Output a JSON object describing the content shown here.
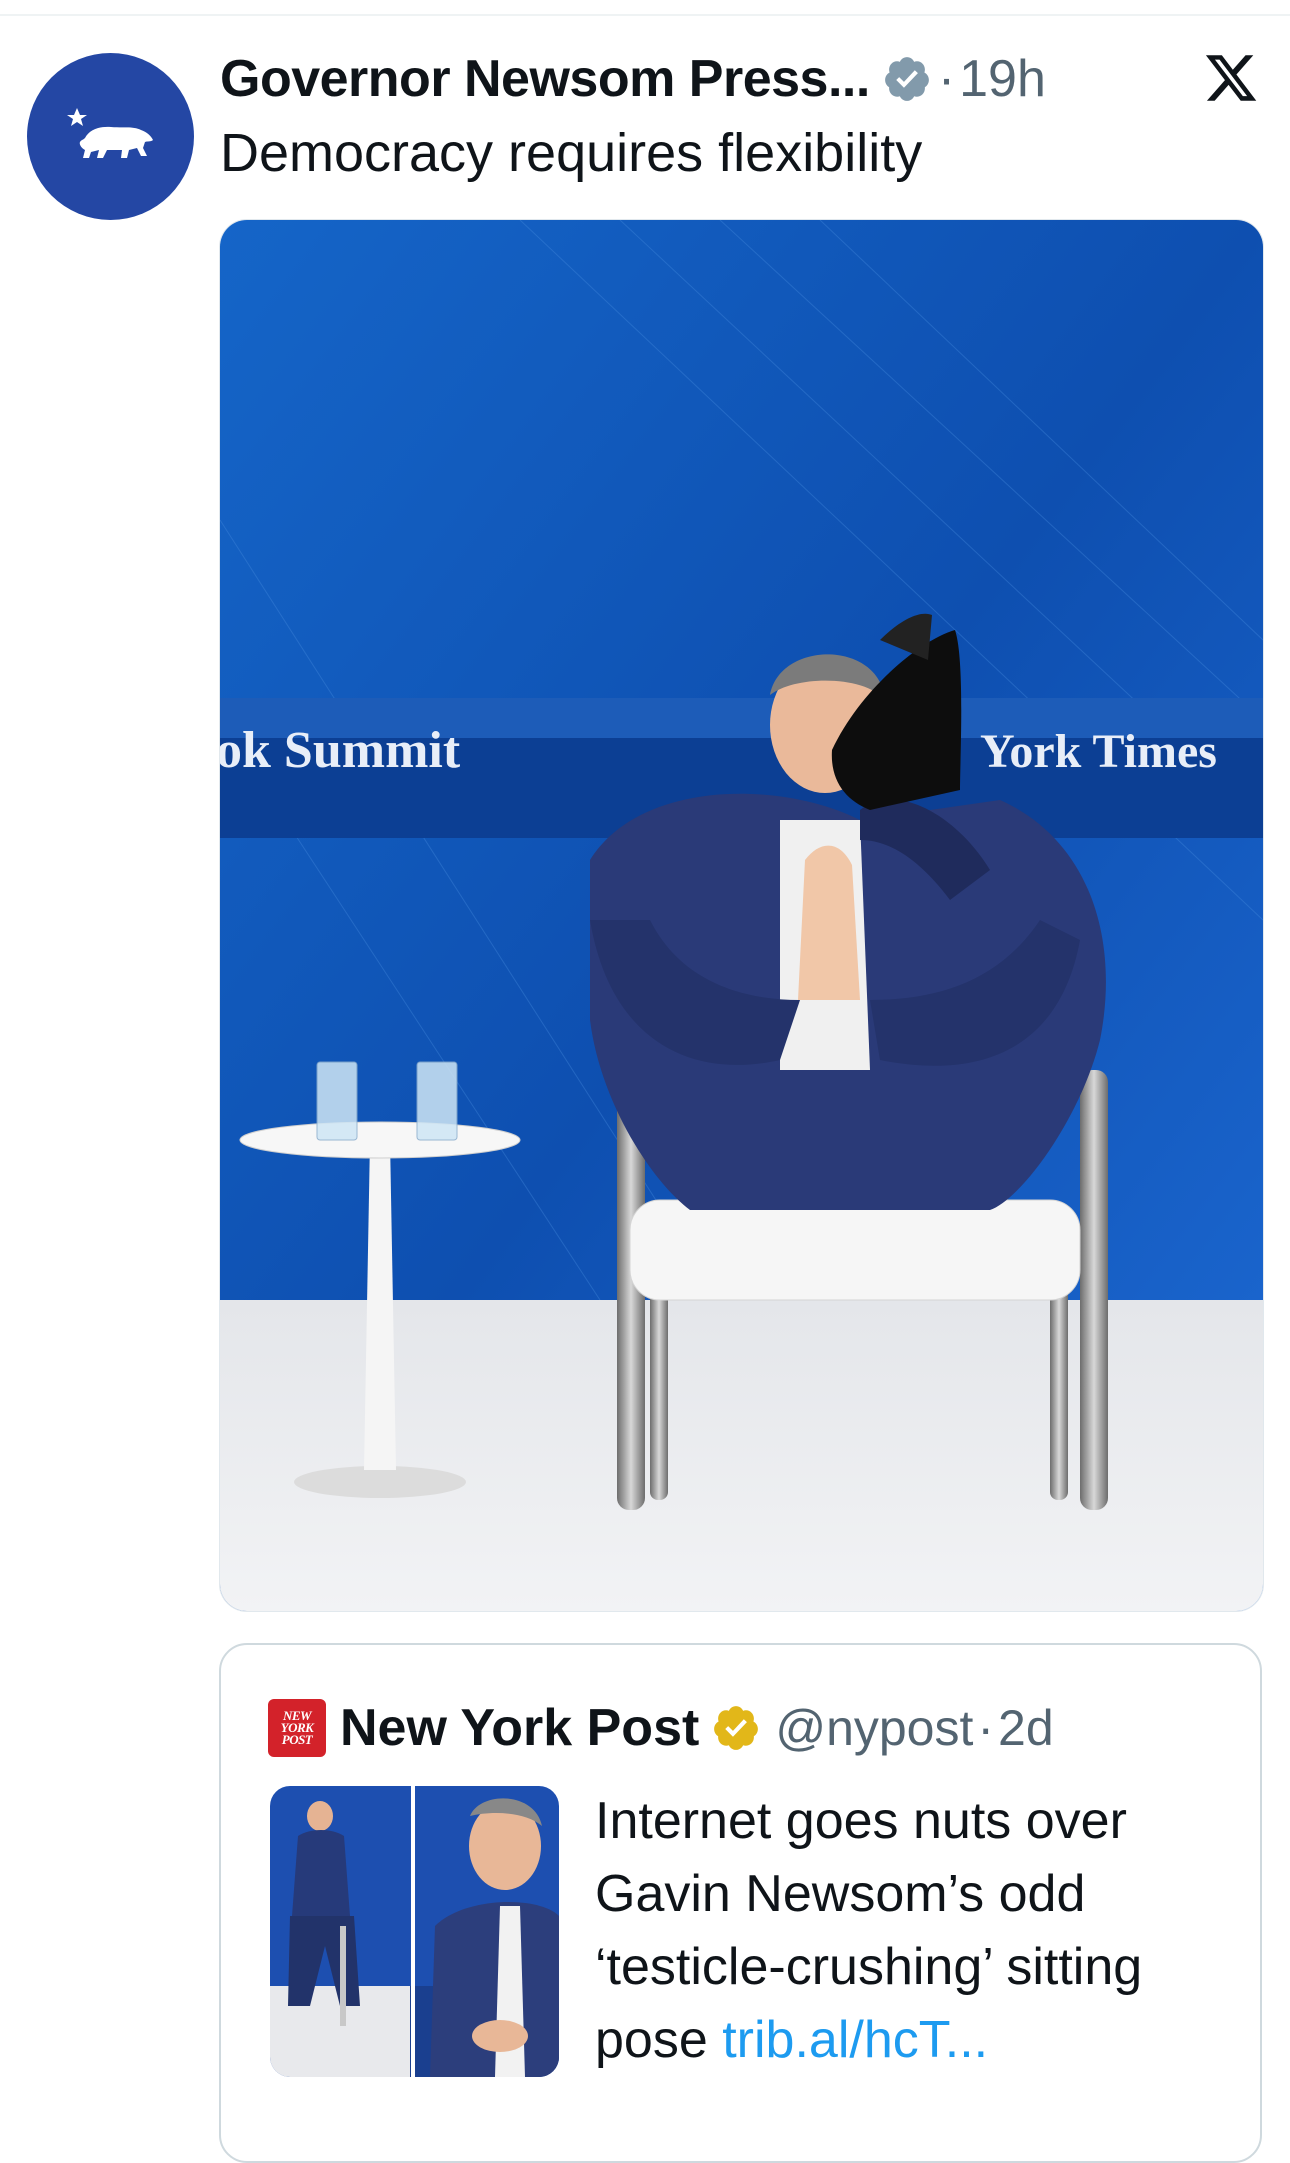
{
  "tweet": {
    "author_name": "Governor Newsom Press...",
    "verified_icon": "verified-badge-icon",
    "separator": "·",
    "timestamp": "19h",
    "text": "Democracy requires flexibility",
    "avatar_icon": "california-bear-icon",
    "platform_icon": "x-logo-icon"
  },
  "media": {
    "backdrop_left_text": "ok Summit",
    "backdrop_right_text": "York Times"
  },
  "quote": {
    "logo_lines": [
      "NEW",
      "YORK",
      "POST"
    ],
    "author_name": "New York Post",
    "verified_icon": "gold-verified-badge-icon",
    "handle": "@nypost",
    "separator": "·",
    "timestamp": "2d",
    "text": "Internet goes nuts over Gavin Newsom’s odd ‘testicle-crushing’ sitting pose ",
    "link_text": "trib.al/hcT..."
  },
  "colors": {
    "avatar_bg": "#2447a4",
    "link": "#1d9bf0",
    "verified_blue": "#829aab",
    "verified_gold": "#e2b719",
    "nypost_red": "#d3222a",
    "secondary_text": "#536471"
  }
}
